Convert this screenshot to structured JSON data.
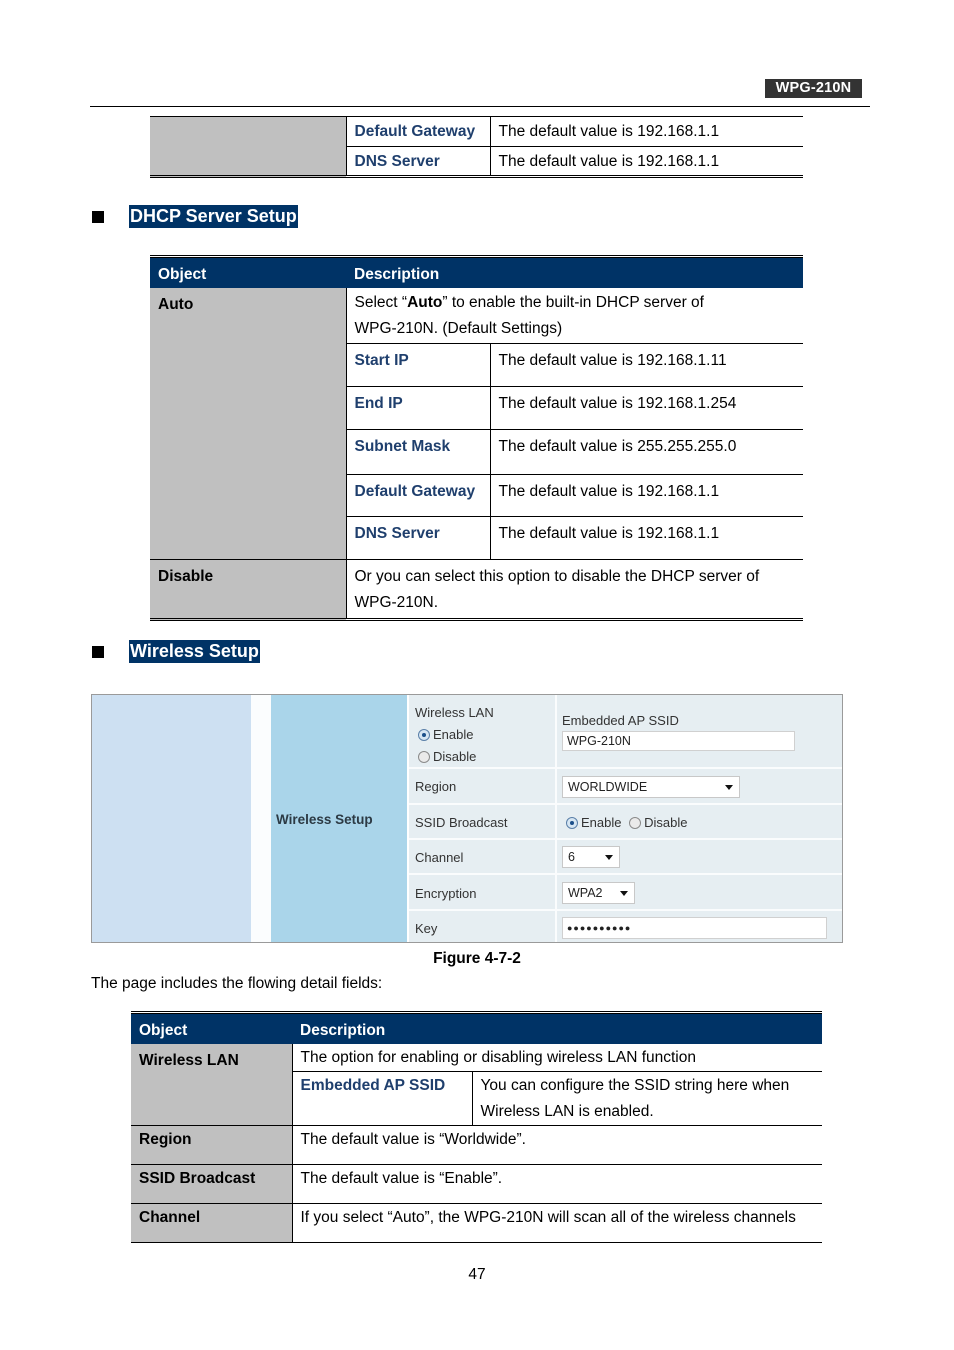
{
  "header": {
    "model": "WPG-210N"
  },
  "top_table": {
    "rows": [
      {
        "label": "Default Gateway",
        "value": "The default value is 192.168.1.1"
      },
      {
        "label": "DNS Server",
        "value": "The default value is 192.168.1.1"
      }
    ]
  },
  "dhcp_section": {
    "title": "DHCP Server Setup",
    "header": {
      "object": "Object",
      "description": "Description"
    },
    "auto": {
      "object": "Auto",
      "desc_prefix": "Select “",
      "desc_bold": "Auto",
      "desc_suffix": "” to enable the built-in DHCP server of",
      "desc_line2": "WPG-210N. (Default Settings)",
      "sub_rows": [
        {
          "label": "Start IP",
          "value": "The default value is 192.168.1.11"
        },
        {
          "label": "End IP",
          "value": "The default value is 192.168.1.254"
        },
        {
          "label": "Subnet Mask",
          "value": "The default value is 255.255.255.0"
        },
        {
          "label": "Default Gateway",
          "value": "The default value is 192.168.1.1"
        },
        {
          "label": "DNS Server",
          "value": "The default value is 192.168.1.1"
        }
      ]
    },
    "disable": {
      "object": "Disable",
      "line1": "Or you can select this option to disable the DHCP server of",
      "line2": "WPG-210N."
    }
  },
  "wireless_section": {
    "title": "Wireless Setup",
    "figure": {
      "side_label": "Wireless Setup",
      "wireless_lan": {
        "label": "Wireless LAN",
        "enable": "Enable",
        "disable": "Disable",
        "selected": "Enable"
      },
      "ssid": {
        "label": "Embedded AP SSID",
        "value": "WPG-210N"
      },
      "region": {
        "label": "Region",
        "value": "WORLDWIDE"
      },
      "ssid_broadcast": {
        "label": "SSID Broadcast",
        "enable": "Enable",
        "disable": "Disable",
        "selected": "Enable"
      },
      "channel": {
        "label": "Channel",
        "value": "6"
      },
      "encryption": {
        "label": "Encryption",
        "value": "WPA2"
      },
      "key": {
        "label": "Key",
        "value": "●●●●●●●●●●"
      }
    },
    "caption": "Figure 4-7-2",
    "intro": "The page includes the flowing detail fields:",
    "table": {
      "header": {
        "object": "Object",
        "description": "Description"
      },
      "wireless_lan": {
        "object": "Wireless LAN",
        "desc": "The option for enabling or disabling wireless LAN function",
        "sub_label": "Embedded AP SSID",
        "sub_line1": "You can configure the SSID string here when",
        "sub_line2": "Wireless LAN is enabled."
      },
      "rows": [
        {
          "object": "Region",
          "desc": "The default value is “Worldwide”."
        },
        {
          "object": "SSID Broadcast",
          "desc": "The default value is “Enable”."
        },
        {
          "object": "Channel",
          "desc": "If you select “Auto”, the WPG-210N will scan all of the wireless channels"
        }
      ]
    }
  },
  "footer": {
    "page_number": "47"
  }
}
